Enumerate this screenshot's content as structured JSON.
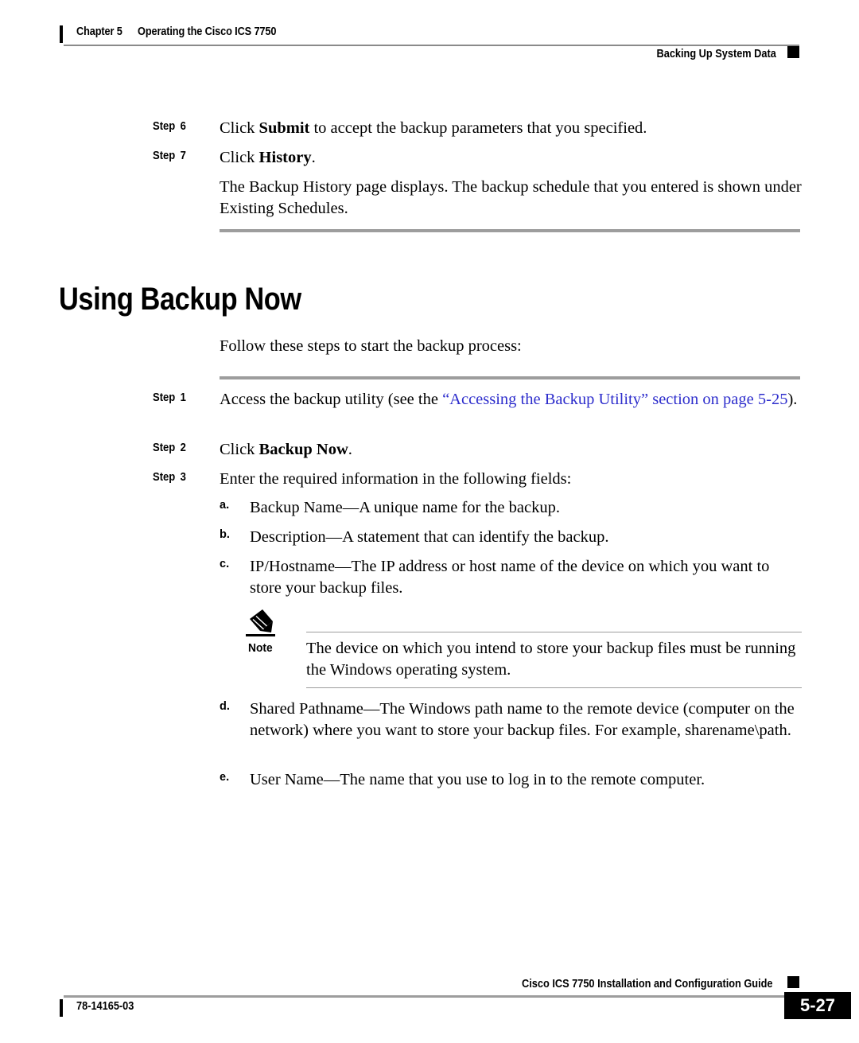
{
  "header": {
    "chapter_label": "Chapter 5",
    "chapter_title": "Operating the Cisco ICS 7750",
    "section_title": "Backing Up System Data"
  },
  "body": {
    "step6": {
      "label": "Step",
      "number": "6",
      "text_before": "Click ",
      "bold": "Submit",
      "text_after": " to accept the backup parameters that you specified."
    },
    "step7": {
      "label": "Step",
      "number": "7",
      "text_before": "Click ",
      "bold": "History",
      "text_after": "."
    },
    "step7_result": "The Backup History page displays. The backup schedule that you entered is shown under Existing Schedules.",
    "heading": "Using Backup Now",
    "intro": "Follow these steps to start the backup process:",
    "step1": {
      "label": "Step",
      "number": "1",
      "text_before": "Access the backup utility (see the ",
      "xref": "“Accessing the Backup Utility” section on page 5-25",
      "text_after": ")."
    },
    "step2": {
      "label": "Step",
      "number": "2",
      "text_before": "Click ",
      "bold": "Backup Now",
      "text_after": "."
    },
    "step3": {
      "label": "Step",
      "number": "3",
      "text": "Enter the required information in the following fields:"
    },
    "fields": [
      {
        "marker": "a.",
        "term": "Backup Name",
        "description": "—A unique name for the backup."
      },
      {
        "marker": "b.",
        "term": "Description",
        "description": "—A statement that can identify the backup."
      },
      {
        "marker": "c.",
        "term": "IP/Hostname",
        "description": "—The IP address or host name of the device on which you want to store your backup files."
      },
      {
        "marker": "d.",
        "term": "Shared Pathname",
        "description": "—The Windows path name to the remote device (computer on the network) where you want to store your backup files. For example, sharename\\path."
      },
      {
        "marker": "e.",
        "term": "User Name",
        "description": "—The name that you use to log in to the remote computer."
      }
    ],
    "note": {
      "label": "Note",
      "icon": "pencil-icon",
      "text": "The device on which you intend to store your backup files must be running the Windows operating system."
    }
  },
  "footer": {
    "guide_title": "Cisco ICS 7750 Installation and Configuration Guide",
    "doc_number": "78-14165-03",
    "page_number": "5-27"
  },
  "colors": {
    "xref_blue": "#2d2dcc",
    "rule_gray": "#9d9d9d",
    "ink": "#000000",
    "page_background": "#ffffff"
  }
}
